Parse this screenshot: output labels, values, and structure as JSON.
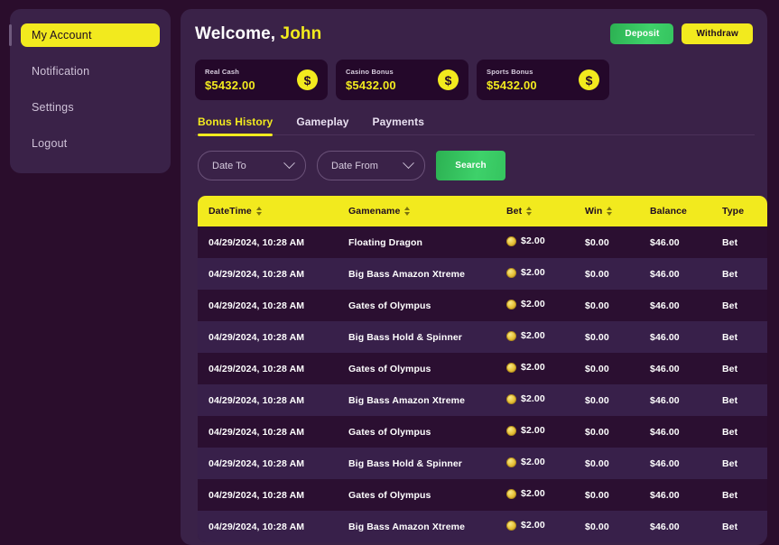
{
  "sidebar": {
    "items": [
      {
        "label": "My Account",
        "name": "my-account",
        "active": true
      },
      {
        "label": "Notification",
        "name": "notification",
        "active": false
      },
      {
        "label": "Settings",
        "name": "settings",
        "active": false
      },
      {
        "label": "Logout",
        "name": "logout",
        "active": false
      }
    ]
  },
  "header": {
    "greeting": "Welcome,",
    "username": "John",
    "deposit_label": "Deposit",
    "withdraw_label": "Withdraw"
  },
  "balances": [
    {
      "label": "Real Cash",
      "amount": "$5432.00",
      "icon": "dollar-coin-icon",
      "symbol": "$"
    },
    {
      "label": "Casino Bonus",
      "amount": "$5432.00",
      "icon": "dollar-coin-icon",
      "symbol": "$"
    },
    {
      "label": "Sports Bonus",
      "amount": "$5432.00",
      "icon": "dollar-coin-icon",
      "symbol": "$"
    }
  ],
  "tabs": [
    {
      "label": "Bonus History",
      "name": "bonus-history",
      "active": true
    },
    {
      "label": "Gameplay",
      "name": "gameplay",
      "active": false
    },
    {
      "label": "Payments",
      "name": "payments",
      "active": false
    }
  ],
  "filters": {
    "date_to": {
      "label": "Date To",
      "icon": "chevron-down-icon"
    },
    "date_from": {
      "label": "Date From",
      "icon": "chevron-down-icon"
    },
    "search_label": "Search"
  },
  "table": {
    "columns": [
      {
        "label": "DateTime",
        "sortable": true,
        "name": "datetime"
      },
      {
        "label": "Gamename",
        "sortable": true,
        "name": "gamename"
      },
      {
        "label": "Bet",
        "sortable": true,
        "name": "bet"
      },
      {
        "label": "Win",
        "sortable": true,
        "name": "win"
      },
      {
        "label": "Balance",
        "sortable": false,
        "name": "balance"
      },
      {
        "label": "Type",
        "sortable": false,
        "name": "type"
      }
    ],
    "rows": [
      {
        "datetime": "04/29/2024, 10:28 AM",
        "gamename": "Floating Dragon",
        "bet": "$2.00",
        "win": "$0.00",
        "balance": "$46.00",
        "type": "Bet"
      },
      {
        "datetime": "04/29/2024, 10:28 AM",
        "gamename": "Big Bass Amazon Xtreme",
        "bet": "$2.00",
        "win": "$0.00",
        "balance": "$46.00",
        "type": "Bet"
      },
      {
        "datetime": "04/29/2024, 10:28 AM",
        "gamename": "Gates of Olympus",
        "bet": "$2.00",
        "win": "$0.00",
        "balance": "$46.00",
        "type": "Bet"
      },
      {
        "datetime": "04/29/2024, 10:28 AM",
        "gamename": "Big Bass Hold & Spinner",
        "bet": "$2.00",
        "win": "$0.00",
        "balance": "$46.00",
        "type": "Bet"
      },
      {
        "datetime": "04/29/2024, 10:28 AM",
        "gamename": "Gates of Olympus",
        "bet": "$2.00",
        "win": "$0.00",
        "balance": "$46.00",
        "type": "Bet"
      },
      {
        "datetime": "04/29/2024, 10:28 AM",
        "gamename": "Big Bass Amazon Xtreme",
        "bet": "$2.00",
        "win": "$0.00",
        "balance": "$46.00",
        "type": "Bet"
      },
      {
        "datetime": "04/29/2024, 10:28 AM",
        "gamename": "Gates of Olympus",
        "bet": "$2.00",
        "win": "$0.00",
        "balance": "$46.00",
        "type": "Bet"
      },
      {
        "datetime": "04/29/2024, 10:28 AM",
        "gamename": "Big Bass Hold & Spinner",
        "bet": "$2.00",
        "win": "$0.00",
        "balance": "$46.00",
        "type": "Bet"
      },
      {
        "datetime": "04/29/2024, 10:28 AM",
        "gamename": "Gates of Olympus",
        "bet": "$2.00",
        "win": "$0.00",
        "balance": "$46.00",
        "type": "Bet"
      },
      {
        "datetime": "04/29/2024, 10:28 AM",
        "gamename": "Big Bass Amazon Xtreme",
        "bet": "$2.00",
        "win": "$0.00",
        "balance": "$46.00",
        "type": "Bet"
      }
    ]
  },
  "colors": {
    "page_bg": "#2a0d2c",
    "panel_bg": "#3a2248",
    "card_bg": "#24082a",
    "accent_yellow": "#f2ea1e",
    "accent_green": "#35c45f",
    "row_dark": "#2b0f31",
    "row_light": "#38204a"
  }
}
